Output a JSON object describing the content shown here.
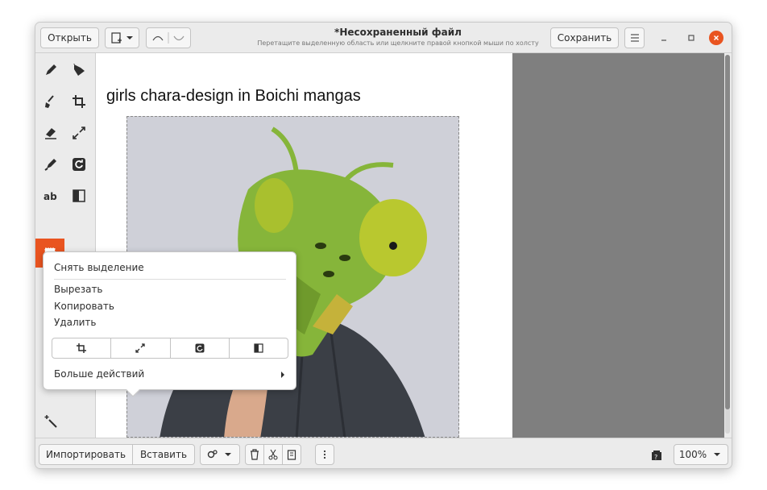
{
  "header": {
    "open_label": "Открыть",
    "title": "*Несохраненный файл",
    "subtitle": "Перетащите выделенную область или щелкните правой кнопкой мыши по холсту",
    "save_label": "Сохранить"
  },
  "canvas": {
    "text": "girls chara-design in Boichi mangas"
  },
  "popover": {
    "unselect": "Снять выделение",
    "cut": "Вырезать",
    "copy": "Копировать",
    "delete": "Удалить",
    "more": "Больше действий"
  },
  "bottombar": {
    "import_label": "Импортировать",
    "paste_label": "Вставить",
    "zoom": "100%"
  },
  "colors": {
    "accent": "#e95420",
    "canvas_bg": "#7f7f7f"
  },
  "icons": [
    "pencil-icon",
    "fill-icon",
    "brush-icon",
    "crop-icon",
    "eraser-icon",
    "scale-icon",
    "highlighter-icon",
    "rotate-icon",
    "text-icon",
    "filters-icon",
    "selection-icon",
    "magic-wand-icon",
    "undo-icon",
    "redo-icon",
    "menu-icon",
    "trash-icon",
    "scissors-icon",
    "clipboard-icon"
  ]
}
